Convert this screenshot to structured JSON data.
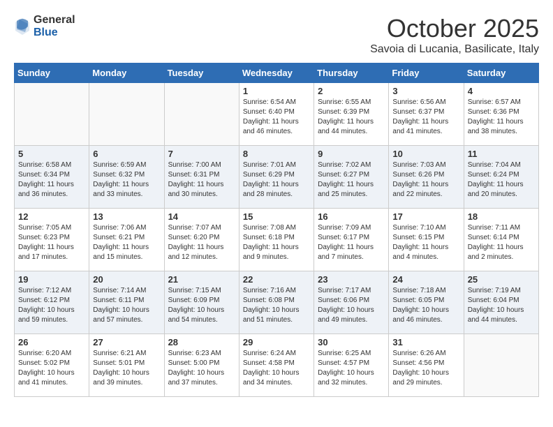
{
  "header": {
    "logo_general": "General",
    "logo_blue": "Blue",
    "month": "October 2025",
    "location": "Savoia di Lucania, Basilicate, Italy"
  },
  "days_of_week": [
    "Sunday",
    "Monday",
    "Tuesday",
    "Wednesday",
    "Thursday",
    "Friday",
    "Saturday"
  ],
  "weeks": [
    [
      {
        "day": "",
        "info": ""
      },
      {
        "day": "",
        "info": ""
      },
      {
        "day": "",
        "info": ""
      },
      {
        "day": "1",
        "info": "Sunrise: 6:54 AM\nSunset: 6:40 PM\nDaylight: 11 hours\nand 46 minutes."
      },
      {
        "day": "2",
        "info": "Sunrise: 6:55 AM\nSunset: 6:39 PM\nDaylight: 11 hours\nand 44 minutes."
      },
      {
        "day": "3",
        "info": "Sunrise: 6:56 AM\nSunset: 6:37 PM\nDaylight: 11 hours\nand 41 minutes."
      },
      {
        "day": "4",
        "info": "Sunrise: 6:57 AM\nSunset: 6:36 PM\nDaylight: 11 hours\nand 38 minutes."
      }
    ],
    [
      {
        "day": "5",
        "info": "Sunrise: 6:58 AM\nSunset: 6:34 PM\nDaylight: 11 hours\nand 36 minutes."
      },
      {
        "day": "6",
        "info": "Sunrise: 6:59 AM\nSunset: 6:32 PM\nDaylight: 11 hours\nand 33 minutes."
      },
      {
        "day": "7",
        "info": "Sunrise: 7:00 AM\nSunset: 6:31 PM\nDaylight: 11 hours\nand 30 minutes."
      },
      {
        "day": "8",
        "info": "Sunrise: 7:01 AM\nSunset: 6:29 PM\nDaylight: 11 hours\nand 28 minutes."
      },
      {
        "day": "9",
        "info": "Sunrise: 7:02 AM\nSunset: 6:27 PM\nDaylight: 11 hours\nand 25 minutes."
      },
      {
        "day": "10",
        "info": "Sunrise: 7:03 AM\nSunset: 6:26 PM\nDaylight: 11 hours\nand 22 minutes."
      },
      {
        "day": "11",
        "info": "Sunrise: 7:04 AM\nSunset: 6:24 PM\nDaylight: 11 hours\nand 20 minutes."
      }
    ],
    [
      {
        "day": "12",
        "info": "Sunrise: 7:05 AM\nSunset: 6:23 PM\nDaylight: 11 hours\nand 17 minutes."
      },
      {
        "day": "13",
        "info": "Sunrise: 7:06 AM\nSunset: 6:21 PM\nDaylight: 11 hours\nand 15 minutes."
      },
      {
        "day": "14",
        "info": "Sunrise: 7:07 AM\nSunset: 6:20 PM\nDaylight: 11 hours\nand 12 minutes."
      },
      {
        "day": "15",
        "info": "Sunrise: 7:08 AM\nSunset: 6:18 PM\nDaylight: 11 hours\nand 9 minutes."
      },
      {
        "day": "16",
        "info": "Sunrise: 7:09 AM\nSunset: 6:17 PM\nDaylight: 11 hours\nand 7 minutes."
      },
      {
        "day": "17",
        "info": "Sunrise: 7:10 AM\nSunset: 6:15 PM\nDaylight: 11 hours\nand 4 minutes."
      },
      {
        "day": "18",
        "info": "Sunrise: 7:11 AM\nSunset: 6:14 PM\nDaylight: 11 hours\nand 2 minutes."
      }
    ],
    [
      {
        "day": "19",
        "info": "Sunrise: 7:12 AM\nSunset: 6:12 PM\nDaylight: 10 hours\nand 59 minutes."
      },
      {
        "day": "20",
        "info": "Sunrise: 7:14 AM\nSunset: 6:11 PM\nDaylight: 10 hours\nand 57 minutes."
      },
      {
        "day": "21",
        "info": "Sunrise: 7:15 AM\nSunset: 6:09 PM\nDaylight: 10 hours\nand 54 minutes."
      },
      {
        "day": "22",
        "info": "Sunrise: 7:16 AM\nSunset: 6:08 PM\nDaylight: 10 hours\nand 51 minutes."
      },
      {
        "day": "23",
        "info": "Sunrise: 7:17 AM\nSunset: 6:06 PM\nDaylight: 10 hours\nand 49 minutes."
      },
      {
        "day": "24",
        "info": "Sunrise: 7:18 AM\nSunset: 6:05 PM\nDaylight: 10 hours\nand 46 minutes."
      },
      {
        "day": "25",
        "info": "Sunrise: 7:19 AM\nSunset: 6:04 PM\nDaylight: 10 hours\nand 44 minutes."
      }
    ],
    [
      {
        "day": "26",
        "info": "Sunrise: 6:20 AM\nSunset: 5:02 PM\nDaylight: 10 hours\nand 41 minutes."
      },
      {
        "day": "27",
        "info": "Sunrise: 6:21 AM\nSunset: 5:01 PM\nDaylight: 10 hours\nand 39 minutes."
      },
      {
        "day": "28",
        "info": "Sunrise: 6:23 AM\nSunset: 5:00 PM\nDaylight: 10 hours\nand 37 minutes."
      },
      {
        "day": "29",
        "info": "Sunrise: 6:24 AM\nSunset: 4:58 PM\nDaylight: 10 hours\nand 34 minutes."
      },
      {
        "day": "30",
        "info": "Sunrise: 6:25 AM\nSunset: 4:57 PM\nDaylight: 10 hours\nand 32 minutes."
      },
      {
        "day": "31",
        "info": "Sunrise: 6:26 AM\nSunset: 4:56 PM\nDaylight: 10 hours\nand 29 minutes."
      },
      {
        "day": "",
        "info": ""
      }
    ]
  ]
}
